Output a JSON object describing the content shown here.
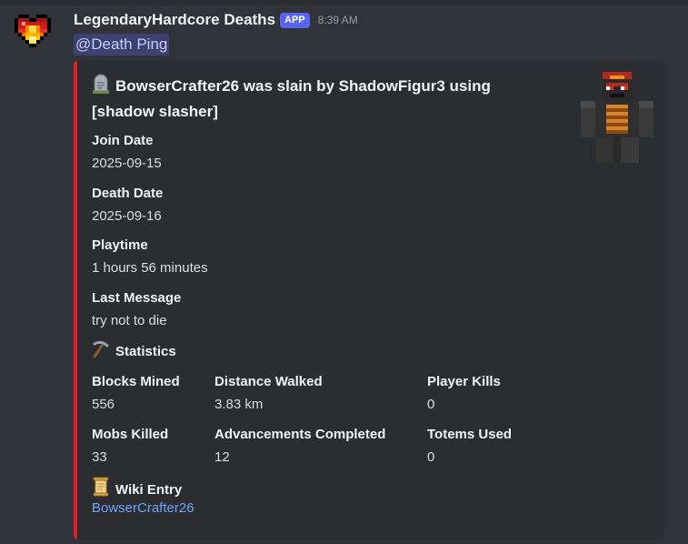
{
  "message": {
    "username": "LegendaryHardcore Deaths",
    "badge": "APP",
    "timestamp": "8:39 AM",
    "mention": "@Death Ping"
  },
  "embed": {
    "accent_color": "#e11d2a",
    "title": "BowserCrafter26 was slain by ShadowFigur3 using [shadow slasher]",
    "title_icon": "headstone-icon",
    "fields": {
      "join_date": {
        "name": "Join Date",
        "value": "2025-09-15"
      },
      "death_date": {
        "name": "Death Date",
        "value": "2025-09-16"
      },
      "playtime": {
        "name": "Playtime",
        "value": "1 hours 56 minutes"
      },
      "last_message": {
        "name": "Last Message",
        "value": "try not to die"
      }
    },
    "statistics": {
      "heading": "Statistics",
      "heading_icon": "pickaxe-icon",
      "items": [
        {
          "name": "Blocks Mined",
          "value": "556"
        },
        {
          "name": "Distance Walked",
          "value": "3.83 km"
        },
        {
          "name": "Player Kills",
          "value": "0"
        },
        {
          "name": "Mobs Killed",
          "value": "33"
        },
        {
          "name": "Advancements Completed",
          "value": "12"
        },
        {
          "name": "Totems Used",
          "value": "0"
        }
      ]
    },
    "wiki": {
      "heading": "Wiki Entry",
      "heading_icon": "scroll-icon",
      "link_text": "BowserCrafter26"
    }
  }
}
